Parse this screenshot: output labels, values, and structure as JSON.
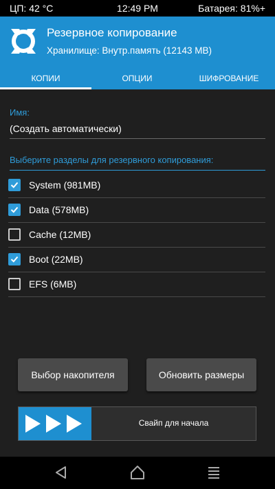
{
  "status_bar": {
    "cpu_temp": "ЦП: 42 °C",
    "time": "12:49 PM",
    "battery": "Батарея: 81%+"
  },
  "header": {
    "title": "Резервное копирование",
    "storage": "Хранилище: Внутр.память (12143 MB)"
  },
  "tabs": [
    {
      "label": "КОПИИ",
      "active": true
    },
    {
      "label": "ОПЦИИ",
      "active": false
    },
    {
      "label": "ШИФРОВАНИЕ",
      "active": false
    }
  ],
  "backup_name": {
    "label": "Имя:",
    "value": "(Создать автоматически)"
  },
  "partitions": {
    "label": "Выберите разделы для резервного копирования:",
    "items": [
      {
        "label": "System (981MB)",
        "checked": true
      },
      {
        "label": "Data (578MB)",
        "checked": true
      },
      {
        "label": "Cache (12MB)",
        "checked": false
      },
      {
        "label": "Boot (22MB)",
        "checked": true
      },
      {
        "label": "EFS (6MB)",
        "checked": false
      }
    ]
  },
  "buttons": {
    "select_storage": "Выбор накопителя",
    "refresh_sizes": "Обновить размеры"
  },
  "swipe": {
    "label": "Свайп для начала"
  },
  "colors": {
    "accent": "#1e8fd0",
    "background": "#1f1f1f",
    "button": "#4a4a4a"
  }
}
